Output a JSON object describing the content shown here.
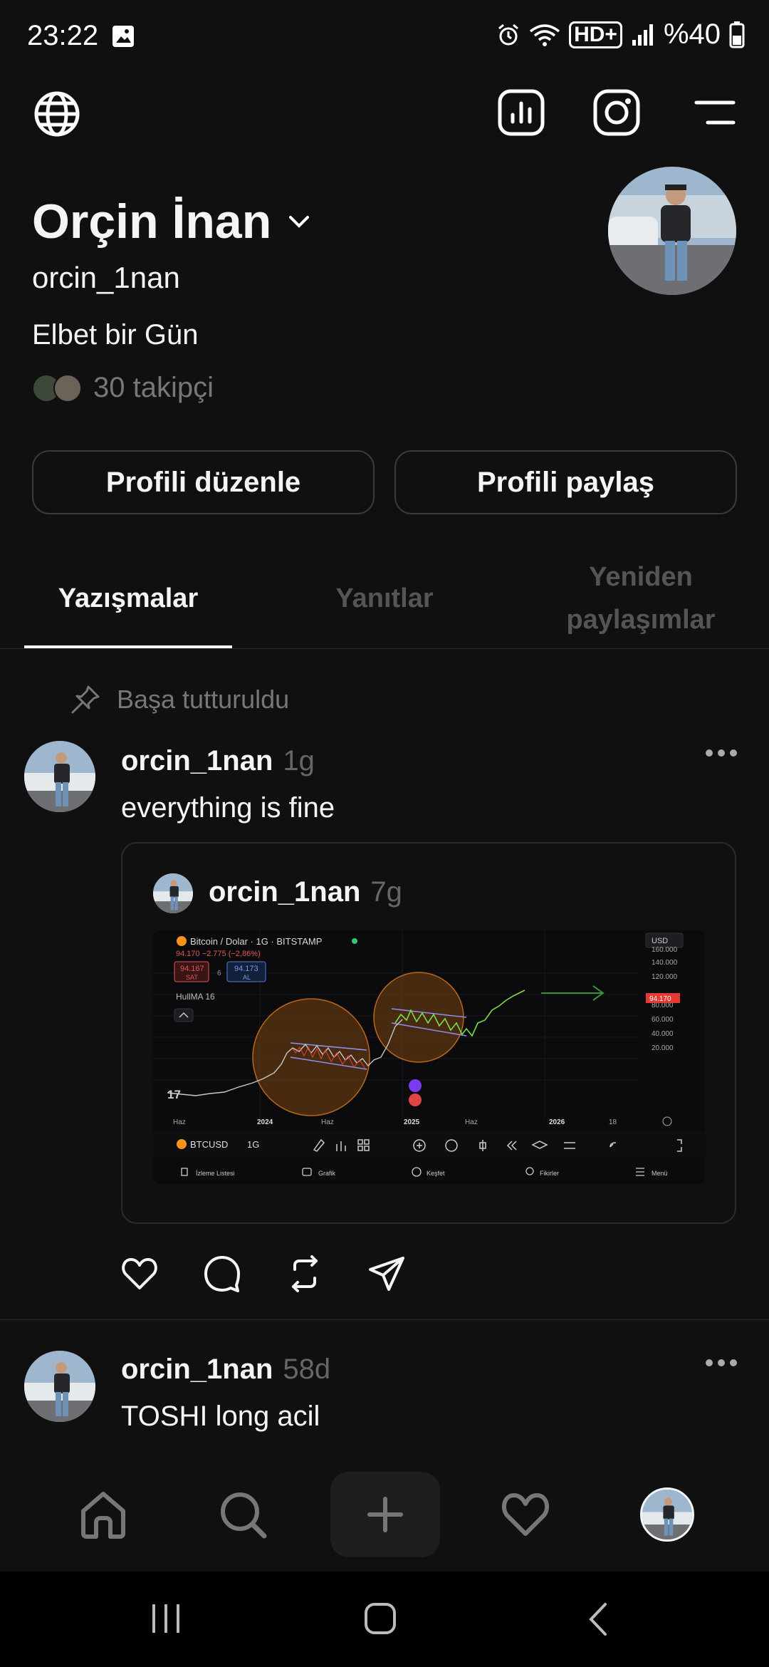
{
  "status": {
    "time": "23:22",
    "battery": "%40",
    "network": "HD+"
  },
  "profile": {
    "name": "Orçin İnan",
    "handle": "orcin_1nan",
    "bio": "Elbet bir Gün",
    "followers": "30 takipçi",
    "edit_button": "Profili düzenle",
    "share_button": "Profili paylaş"
  },
  "tabs": [
    {
      "label": "Yazışmalar"
    },
    {
      "label": "Yanıtlar"
    },
    {
      "label": "Yeniden paylaşımlar"
    }
  ],
  "pinned_label": "Başa tutturuldu",
  "posts": [
    {
      "user": "orcin_1nan",
      "time": "1g",
      "text": "everything is fine",
      "quote": {
        "user": "orcin_1nan",
        "time": "7g",
        "chart": {
          "title": "Bitcoin / Dolar · 1G · BITSTAMP",
          "price_line": "94.170 −2.775 (−2,86%)",
          "sell_price": "94.167",
          "sell_label": "SAT",
          "spread": "6",
          "buy_price": "94.173",
          "buy_label": "AL",
          "indicator": "HullMA 16",
          "currency": "USD",
          "symbol": "BTCUSD",
          "interval": "1G",
          "current_price": "94.170",
          "price_scale": [
            "160.000",
            "140.000",
            "120.000",
            "80.000",
            "60.000",
            "40.000",
            "20.000"
          ],
          "time_axis": [
            "Haz",
            "2024",
            "Haz",
            "2025",
            "Haz",
            "2026",
            "18"
          ],
          "bottom_menu": [
            "İzleme Listesi",
            "Grafik",
            "Keşfet",
            "Fikirler",
            "Menü"
          ]
        }
      }
    },
    {
      "user": "orcin_1nan",
      "time": "58d",
      "text": "TOSHI long acil"
    }
  ],
  "colors": {
    "background": "#101010",
    "text": "#f3f5f7",
    "muted": "#777777",
    "border": "#3a3a3a",
    "chart_green": "#4caf50",
    "chart_red": "#e53935"
  }
}
